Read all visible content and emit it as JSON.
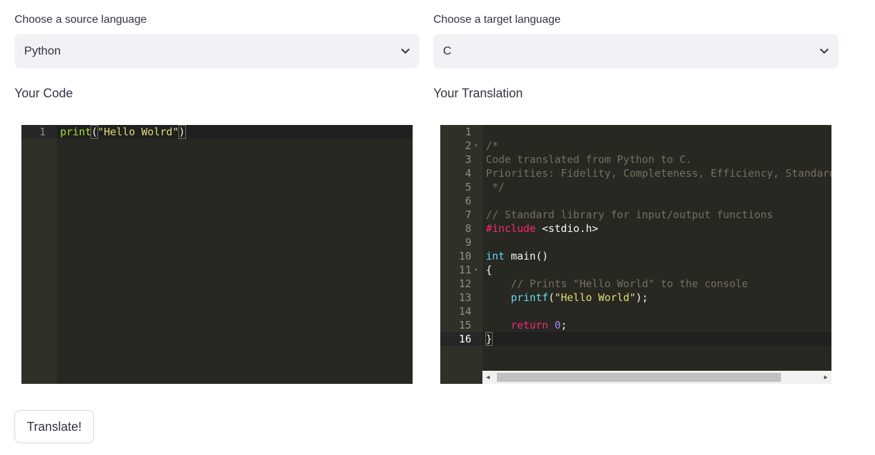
{
  "source": {
    "label": "Choose a source language",
    "selected": "Python",
    "editor_title": "Your Code",
    "lines": [
      {
        "n": "1",
        "tokens": [
          {
            "t": "print",
            "c": "t-func"
          },
          {
            "t": "(",
            "c": "paren-box"
          },
          {
            "t": "\"Hello Wolrd\"",
            "c": "t-str"
          },
          {
            "t": ")",
            "c": "paren-box"
          }
        ]
      }
    ]
  },
  "target": {
    "label": "Choose a target language",
    "selected": "C",
    "editor_title": "Your Translation",
    "lines": [
      {
        "n": "1",
        "tokens": []
      },
      {
        "n": "2",
        "fold": true,
        "tokens": [
          {
            "t": "/*",
            "c": "t-com"
          }
        ]
      },
      {
        "n": "3",
        "tokens": [
          {
            "t": "Code translated from Python to C.",
            "c": "t-com"
          }
        ]
      },
      {
        "n": "4",
        "tokens": [
          {
            "t": "Priorities: Fidelity, Completeness, Efficiency, Standards",
            "c": "t-com"
          }
        ]
      },
      {
        "n": "5",
        "tokens": [
          {
            "t": " */",
            "c": "t-com"
          }
        ]
      },
      {
        "n": "6",
        "tokens": []
      },
      {
        "n": "7",
        "tokens": [
          {
            "t": "// Standard library for input/output functions",
            "c": "t-com"
          }
        ]
      },
      {
        "n": "8",
        "tokens": [
          {
            "t": "#include",
            "c": "t-kw"
          },
          {
            "t": " <stdio.h>",
            "c": ""
          }
        ]
      },
      {
        "n": "9",
        "tokens": []
      },
      {
        "n": "10",
        "tokens": [
          {
            "t": "int",
            "c": "t-type"
          },
          {
            "t": " main()",
            "c": ""
          }
        ]
      },
      {
        "n": "11",
        "fold": true,
        "tokens": [
          {
            "t": "{",
            "c": ""
          }
        ]
      },
      {
        "n": "12",
        "tokens": [
          {
            "t": "    // Prints \"Hello World\" to the console",
            "c": "t-com"
          }
        ]
      },
      {
        "n": "13",
        "tokens": [
          {
            "t": "    ",
            "c": ""
          },
          {
            "t": "printf",
            "c": "t-fn-ref"
          },
          {
            "t": "(",
            "c": ""
          },
          {
            "t": "\"Hello World\"",
            "c": "t-str"
          },
          {
            "t": ");",
            "c": ""
          }
        ]
      },
      {
        "n": "14",
        "tokens": []
      },
      {
        "n": "15",
        "tokens": [
          {
            "t": "    ",
            "c": ""
          },
          {
            "t": "return",
            "c": "t-kw"
          },
          {
            "t": " ",
            "c": ""
          },
          {
            "t": "0",
            "c": "t-num"
          },
          {
            "t": ";",
            "c": ""
          }
        ]
      },
      {
        "n": "16",
        "active": true,
        "tokens": [
          {
            "t": "}",
            "c": "paren-box"
          }
        ]
      }
    ]
  },
  "translate_button": "Translate!",
  "icons": {
    "dropdown": "chevron-down-icon",
    "scroll_left": "arrow-left-icon",
    "scroll_right": "arrow-right-icon"
  },
  "colors": {
    "editor_bg": "#272822",
    "select_bg": "#f0f2f6"
  }
}
